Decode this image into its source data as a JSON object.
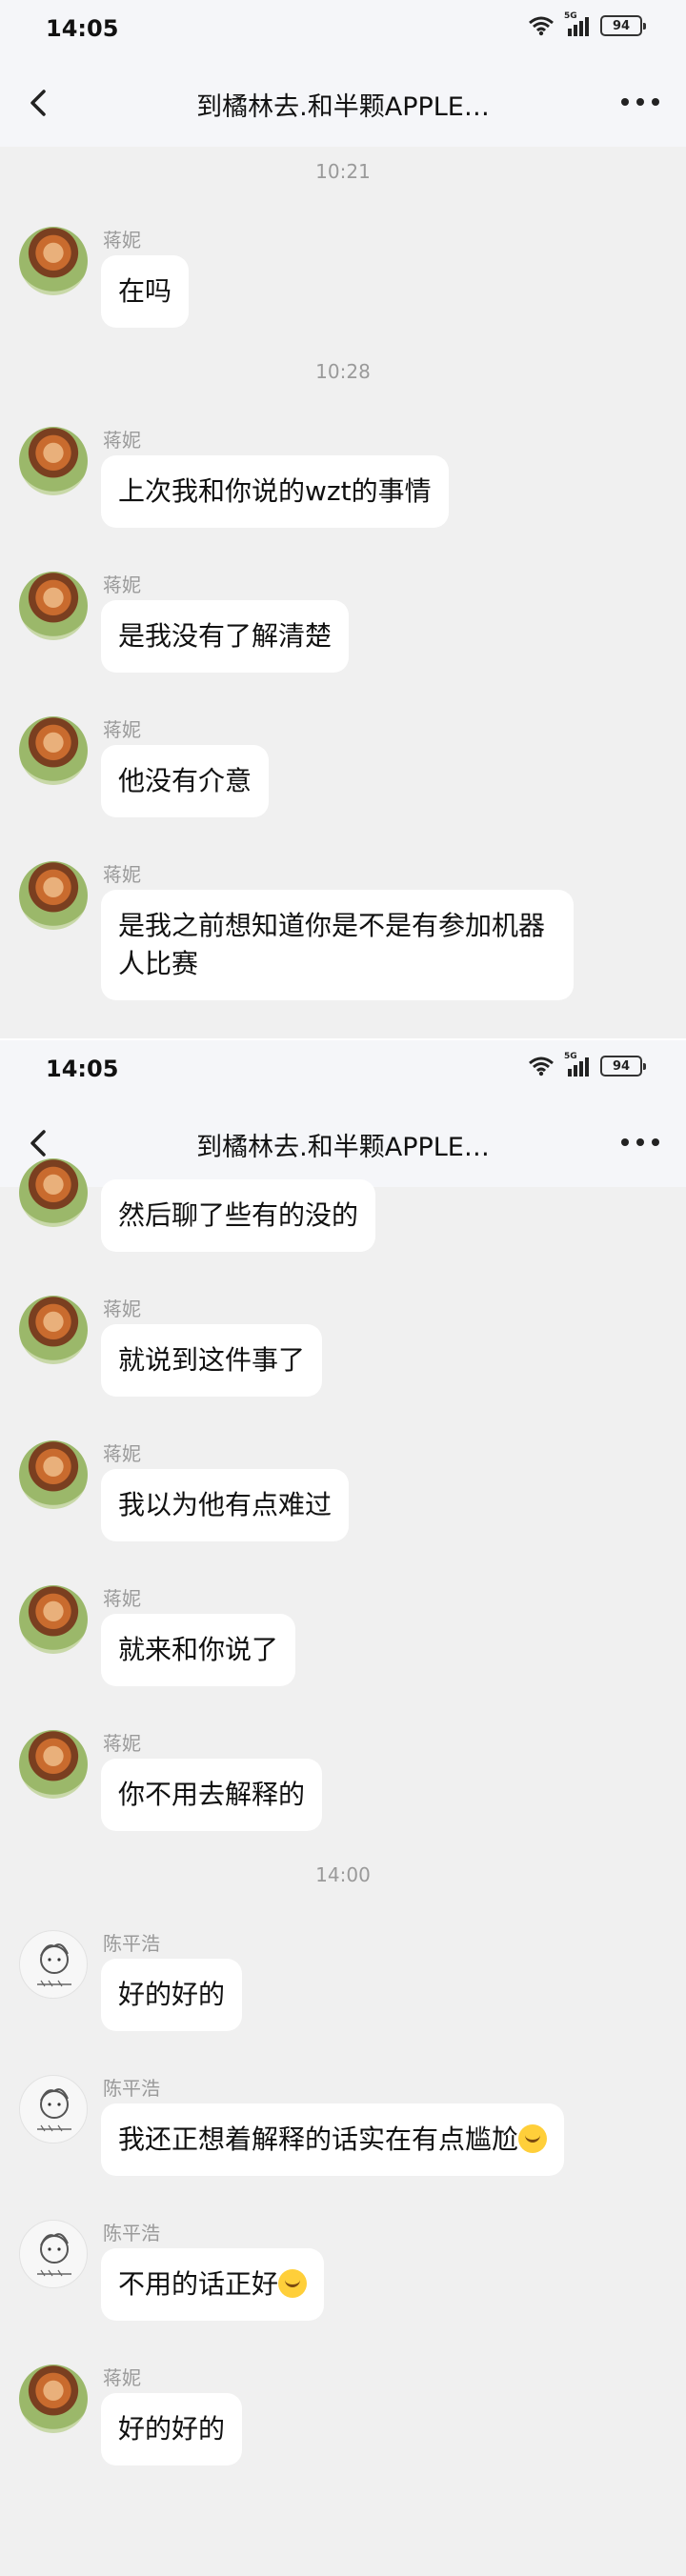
{
  "screen1": {
    "status": {
      "time": "14:05",
      "battery": "94",
      "network": "5G"
    },
    "nav": {
      "title": "到橘林去.和半颗APPLE…"
    },
    "items": [
      {
        "kind": "time",
        "text": "10:21"
      },
      {
        "kind": "msg",
        "sender": "蒋妮",
        "avatar": "jiangni",
        "text": "在吗"
      },
      {
        "kind": "time",
        "text": "10:28"
      },
      {
        "kind": "msg",
        "sender": "蒋妮",
        "avatar": "jiangni",
        "text": "上次我和你说的wzt的事情"
      },
      {
        "kind": "msg",
        "sender": "蒋妮",
        "avatar": "jiangni",
        "text": "是我没有了解清楚"
      },
      {
        "kind": "msg",
        "sender": "蒋妮",
        "avatar": "jiangni",
        "text": "他没有介意"
      },
      {
        "kind": "msg",
        "sender": "蒋妮",
        "avatar": "jiangni",
        "text": "是我之前想知道你是不是有参加机器人比赛"
      },
      {
        "kind": "msg-cut",
        "sender": "蒋妮",
        "avatar": "jiangni",
        "text": ""
      }
    ]
  },
  "screen2": {
    "status": {
      "time": "14:05",
      "battery": "94",
      "network": "5G"
    },
    "nav": {
      "title": "到橘林去.和半颗APPLE…"
    },
    "items": [
      {
        "kind": "msg-partial",
        "sender": "",
        "avatar": "jiangni",
        "text": "然后聊了些有的没的"
      },
      {
        "kind": "msg",
        "sender": "蒋妮",
        "avatar": "jiangni",
        "text": "就说到这件事了"
      },
      {
        "kind": "msg",
        "sender": "蒋妮",
        "avatar": "jiangni",
        "text": "我以为他有点难过"
      },
      {
        "kind": "msg",
        "sender": "蒋妮",
        "avatar": "jiangni",
        "text": "就来和你说了"
      },
      {
        "kind": "msg",
        "sender": "蒋妮",
        "avatar": "jiangni",
        "text": "你不用去解释的"
      },
      {
        "kind": "time",
        "text": "14:00"
      },
      {
        "kind": "msg",
        "sender": "陈平浩",
        "avatar": "chenpinghao",
        "text": "好的好的"
      },
      {
        "kind": "msg",
        "sender": "陈平浩",
        "avatar": "chenpinghao",
        "text": "我还正想着解释的话实在有点尴尬",
        "emoji": "laugh-cry-emoji"
      },
      {
        "kind": "msg",
        "sender": "陈平浩",
        "avatar": "chenpinghao",
        "text": "不用的话正好",
        "emoji": "relieved-emoji"
      },
      {
        "kind": "msg",
        "sender": "蒋妮",
        "avatar": "jiangni",
        "text": "好的好的"
      }
    ]
  },
  "colors": {
    "bubble": "#ffffff",
    "background": "#f0f0f0",
    "header": "#f5f6f9",
    "meta_text": "#9a9a9a"
  }
}
